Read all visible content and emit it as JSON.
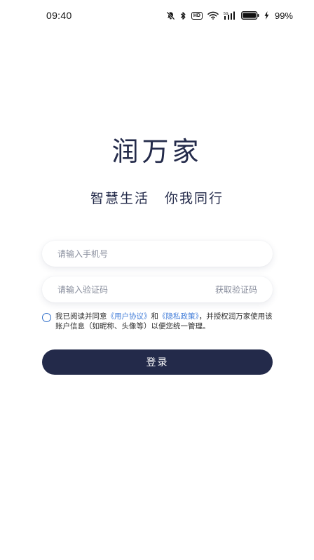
{
  "status_bar": {
    "time": "09:40",
    "hd_label": "HD",
    "battery_percent": "99%",
    "icons": [
      "mute-icon",
      "bluetooth-icon",
      "hd-icon",
      "wifi-icon",
      "signal-icon",
      "battery-icon",
      "charging-icon"
    ]
  },
  "app": {
    "title": "润万家",
    "slogan": "智慧生活 你我同行"
  },
  "form": {
    "phone_placeholder": "请输入手机号",
    "code_placeholder": "请输入验证码",
    "get_code_label": "获取验证码",
    "agreement": {
      "prefix": "我已阅读并同意",
      "user_agreement": "《用户协议》",
      "and": "和",
      "privacy_policy": "《隐私政策》",
      "suffix": "，并授权润万家使用该账户信息（如昵称、头像等）以便您统一管理。"
    },
    "login_label": "登录"
  },
  "colors": {
    "primary": "#232a4a",
    "link": "#3f7bd8",
    "placeholder": "#8a8f9e"
  }
}
